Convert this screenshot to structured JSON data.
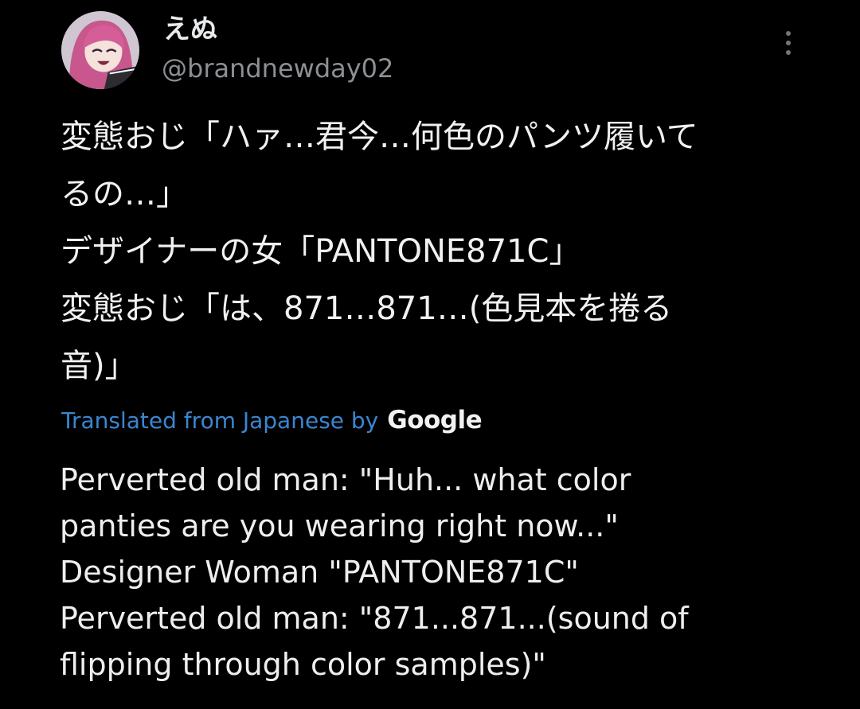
{
  "tweet": {
    "author": {
      "display_name": "えぬ",
      "handle": "@brandnewday02",
      "avatar": "avatar-illustration"
    },
    "more_icon": "more-options-icon",
    "original_text": [
      "変態おじ「ハァ…君今…何色のパンツ履いて",
      "るの…」",
      "デザイナーの女「PANTONE871C」",
      "変態おじ「は、871…871…(色見本を捲る",
      "音)」"
    ],
    "translation": {
      "label": "Translated from Japanese by",
      "provider": "Google",
      "text": [
        "Perverted old man: \"Huh... what color",
        "panties are you wearing right now...\"",
        "Designer Woman \"PANTONE871C\"",
        "Perverted old man: \"871...871...(sound of",
        "flipping through color samples)\""
      ]
    }
  },
  "colors": {
    "background": "#000000",
    "primary_text": "#e7e9ea",
    "secondary_text": "#8b9096",
    "link": "#3a86d0"
  }
}
